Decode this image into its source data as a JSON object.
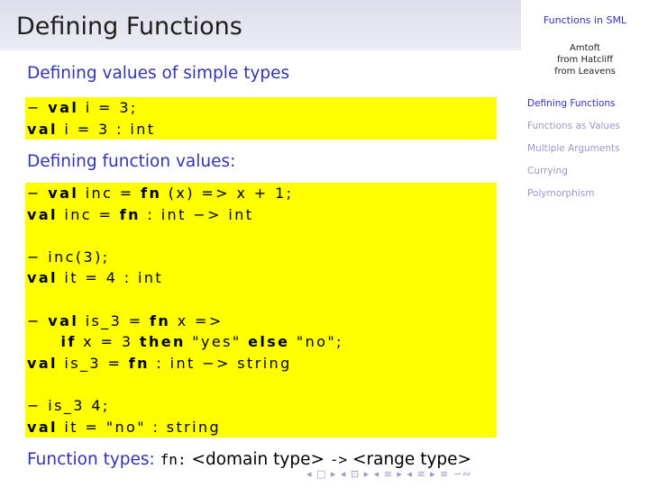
{
  "slide": {
    "title": "Defining Functions"
  },
  "sidebar": {
    "title": "Functions in SML",
    "author_lines": [
      "Amtoft",
      "from Hatcliff",
      "from Leavens"
    ],
    "nav": [
      {
        "label": "Defining Functions",
        "active": true
      },
      {
        "label": "Functions as Values",
        "active": false
      },
      {
        "label": "Multiple Arguments",
        "active": false
      },
      {
        "label": "Currying",
        "active": false
      },
      {
        "label": "Polymorphism",
        "active": false
      }
    ]
  },
  "section1": {
    "heading": "Defining values of simple types",
    "lines": [
      [
        {
          "t": "− "
        },
        {
          "t": "val",
          "kw": true
        },
        {
          "t": " i = 3;"
        }
      ],
      [
        {
          "t": "val",
          "kw": true
        },
        {
          "t": " i = 3 : int"
        }
      ]
    ]
  },
  "section2": {
    "heading": "Defining function values:",
    "lines": [
      [
        {
          "t": "− "
        },
        {
          "t": "val",
          "kw": true
        },
        {
          "t": " inc = "
        },
        {
          "t": "fn",
          "kw": true
        },
        {
          "t": " (x) => x + 1;"
        }
      ],
      [
        {
          "t": "val",
          "kw": true
        },
        {
          "t": " inc = "
        },
        {
          "t": "fn",
          "kw": true
        },
        {
          "t": " : int −> int"
        }
      ],
      [],
      [
        {
          "t": "− inc(3);"
        }
      ],
      [
        {
          "t": "val",
          "kw": true
        },
        {
          "t": " it = 4 : int"
        }
      ],
      [],
      [
        {
          "t": "− "
        },
        {
          "t": "val",
          "kw": true
        },
        {
          "t": " is_3 = "
        },
        {
          "t": "fn",
          "kw": true
        },
        {
          "t": " x =>"
        }
      ],
      [
        {
          "t": "     "
        },
        {
          "t": "if",
          "kw": true
        },
        {
          "t": " x = 3 "
        },
        {
          "t": "then",
          "kw": true
        },
        {
          "t": " \"yes\" "
        },
        {
          "t": "else",
          "kw": true
        },
        {
          "t": " \"no\";"
        }
      ],
      [
        {
          "t": "val",
          "kw": true
        },
        {
          "t": " is_3 = "
        },
        {
          "t": "fn",
          "kw": true
        },
        {
          "t": " : int −> string"
        }
      ],
      [],
      [
        {
          "t": "− is_3 4;"
        }
      ],
      [
        {
          "t": "val",
          "kw": true
        },
        {
          "t": " it = \"no\" : string"
        }
      ]
    ]
  },
  "footer": {
    "label": "Function types:",
    "keyword": "fn:",
    "domain": "<domain type>",
    "arrow": "->",
    "range": "<range type>"
  },
  "beamer_nav": {
    "symbols": "◂ □ ▸ ◂ ⊡ ▸ ◂ ≡ ▸ ◂ ≡ ▸  ≡  ∽∾"
  }
}
